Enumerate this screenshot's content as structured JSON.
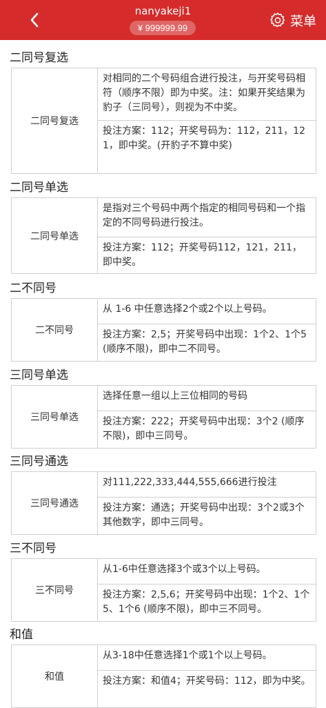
{
  "header": {
    "username": "nanyakeji1",
    "balance": "¥ 999999.99",
    "menu_label": "菜单",
    "back_icon": "chevron-left-icon",
    "menu_icon": "gear-icon",
    "bg_color": "#d52b2b"
  },
  "sections": [
    {
      "title": "二同号复选",
      "name": "二同号复选",
      "rule": "对相同的二个号码组合进行投注，与开奖号码相符（顺序不限）即为中奖。注：如果开奖结果为豹子（三同号），则视为不中奖。",
      "example": "投注方案：112；开奖号码为：112，211，121，即中奖。(开豹子不算中奖)"
    },
    {
      "title": "二同号单选",
      "name": "二同号单选",
      "rule": "是指对三个号码中两个指定的相同号码和一个指定的不同号码进行投注。",
      "example": "投注方案：112；开奖号码112，121，211，即中奖。"
    },
    {
      "title": "二不同号",
      "name": "二不同号",
      "rule": "从 1-6 中任意选择2个或2个以上号码。",
      "example": "投注方案：2,5；开奖号码中出现：1个2、1个5 (顺序不限)，即中二不同号。"
    },
    {
      "title": "三同号单选",
      "name": "三同号单选",
      "rule": "选择任意一组以上三位相同的号码",
      "example": "投注方案：222；开奖号码中出现：3个2 (顺序不限)，即中三同号。"
    },
    {
      "title": "三同号通选",
      "name": "三同号通选",
      "rule": "对111,222,333,444,555,666进行投注",
      "example": "投注方案：通选；开奖号码中出现：3个2或3个其他数字，即中三同号。"
    },
    {
      "title": "三不同号",
      "name": "三不同号",
      "rule": "从1-6中任意选择3个或3个以上号码。",
      "example": "投注方案：2,5,6；开奖号码中出现：1个2、1个5、1个6 (顺序不限)，即中三不同号。"
    },
    {
      "title": "和值",
      "name": "和值",
      "rule": "从3-18中任意选择1个或1个以上号码。",
      "example": "投注方案：和值4；开奖号码：112，即为中奖。"
    }
  ]
}
